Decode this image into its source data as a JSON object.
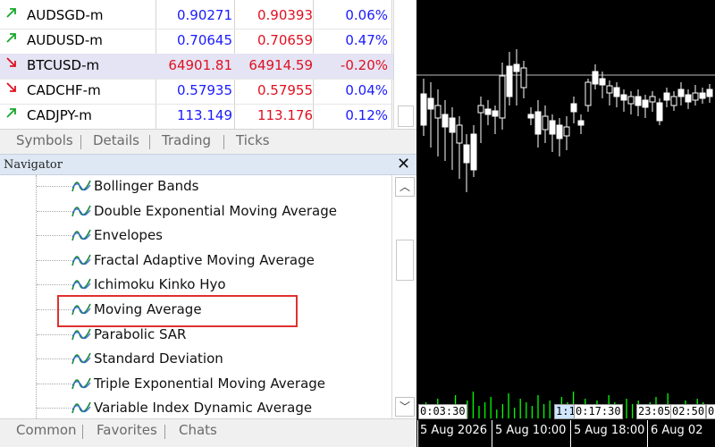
{
  "market_watch": {
    "rows": [
      {
        "symbol": "AUDSGD-m",
        "bid": "0.90271",
        "ask": "0.90393",
        "change": "0.06%",
        "dir": "up"
      },
      {
        "symbol": "AUDUSD-m",
        "bid": "0.70645",
        "ask": "0.70659",
        "change": "0.47%",
        "dir": "up"
      },
      {
        "symbol": "BTCUSD-m",
        "bid": "64901.81",
        "ask": "64914.59",
        "change": "-0.20%",
        "dir": "down"
      },
      {
        "symbol": "CADCHF-m",
        "bid": "0.57935",
        "ask": "0.57955",
        "change": "0.04%",
        "dir": "down"
      },
      {
        "symbol": "CADJPY-m",
        "bid": "113.149",
        "ask": "113.176",
        "change": "0.12%",
        "dir": "up"
      }
    ],
    "tabs": [
      "Symbols",
      "Details",
      "Trading",
      "Ticks"
    ]
  },
  "navigator": {
    "title": "Navigator",
    "close": "✕",
    "items": [
      "Bollinger Bands",
      "Double Exponential Moving Average",
      "Envelopes",
      "Fractal Adaptive Moving Average",
      "Ichimoku Kinko Hyo",
      "Moving Average",
      "Parabolic SAR",
      "Standard Deviation",
      "Triple Exponential Moving Average",
      "Variable Index Dynamic Average"
    ],
    "highlighted": "Moving Average",
    "tabs": [
      "Common",
      "Favorites",
      "Chats"
    ]
  },
  "chart": {
    "time_labels": [
      "0:03:30",
      "1:1",
      "0:17:30",
      "23:05",
      "02:50",
      "0"
    ],
    "date_labels": [
      "5 Aug 2026",
      "5 Aug 10:00",
      "5 Aug 18:00",
      "6 Aug 02"
    ],
    "colors": {
      "background": "#000000",
      "candle": "#ffffff",
      "volume": "#00ff00"
    }
  },
  "icons": {
    "up_arrow": "arrow-up-right-icon",
    "down_arrow": "arrow-down-right-icon",
    "indicator": "indicator-wave-icon"
  }
}
